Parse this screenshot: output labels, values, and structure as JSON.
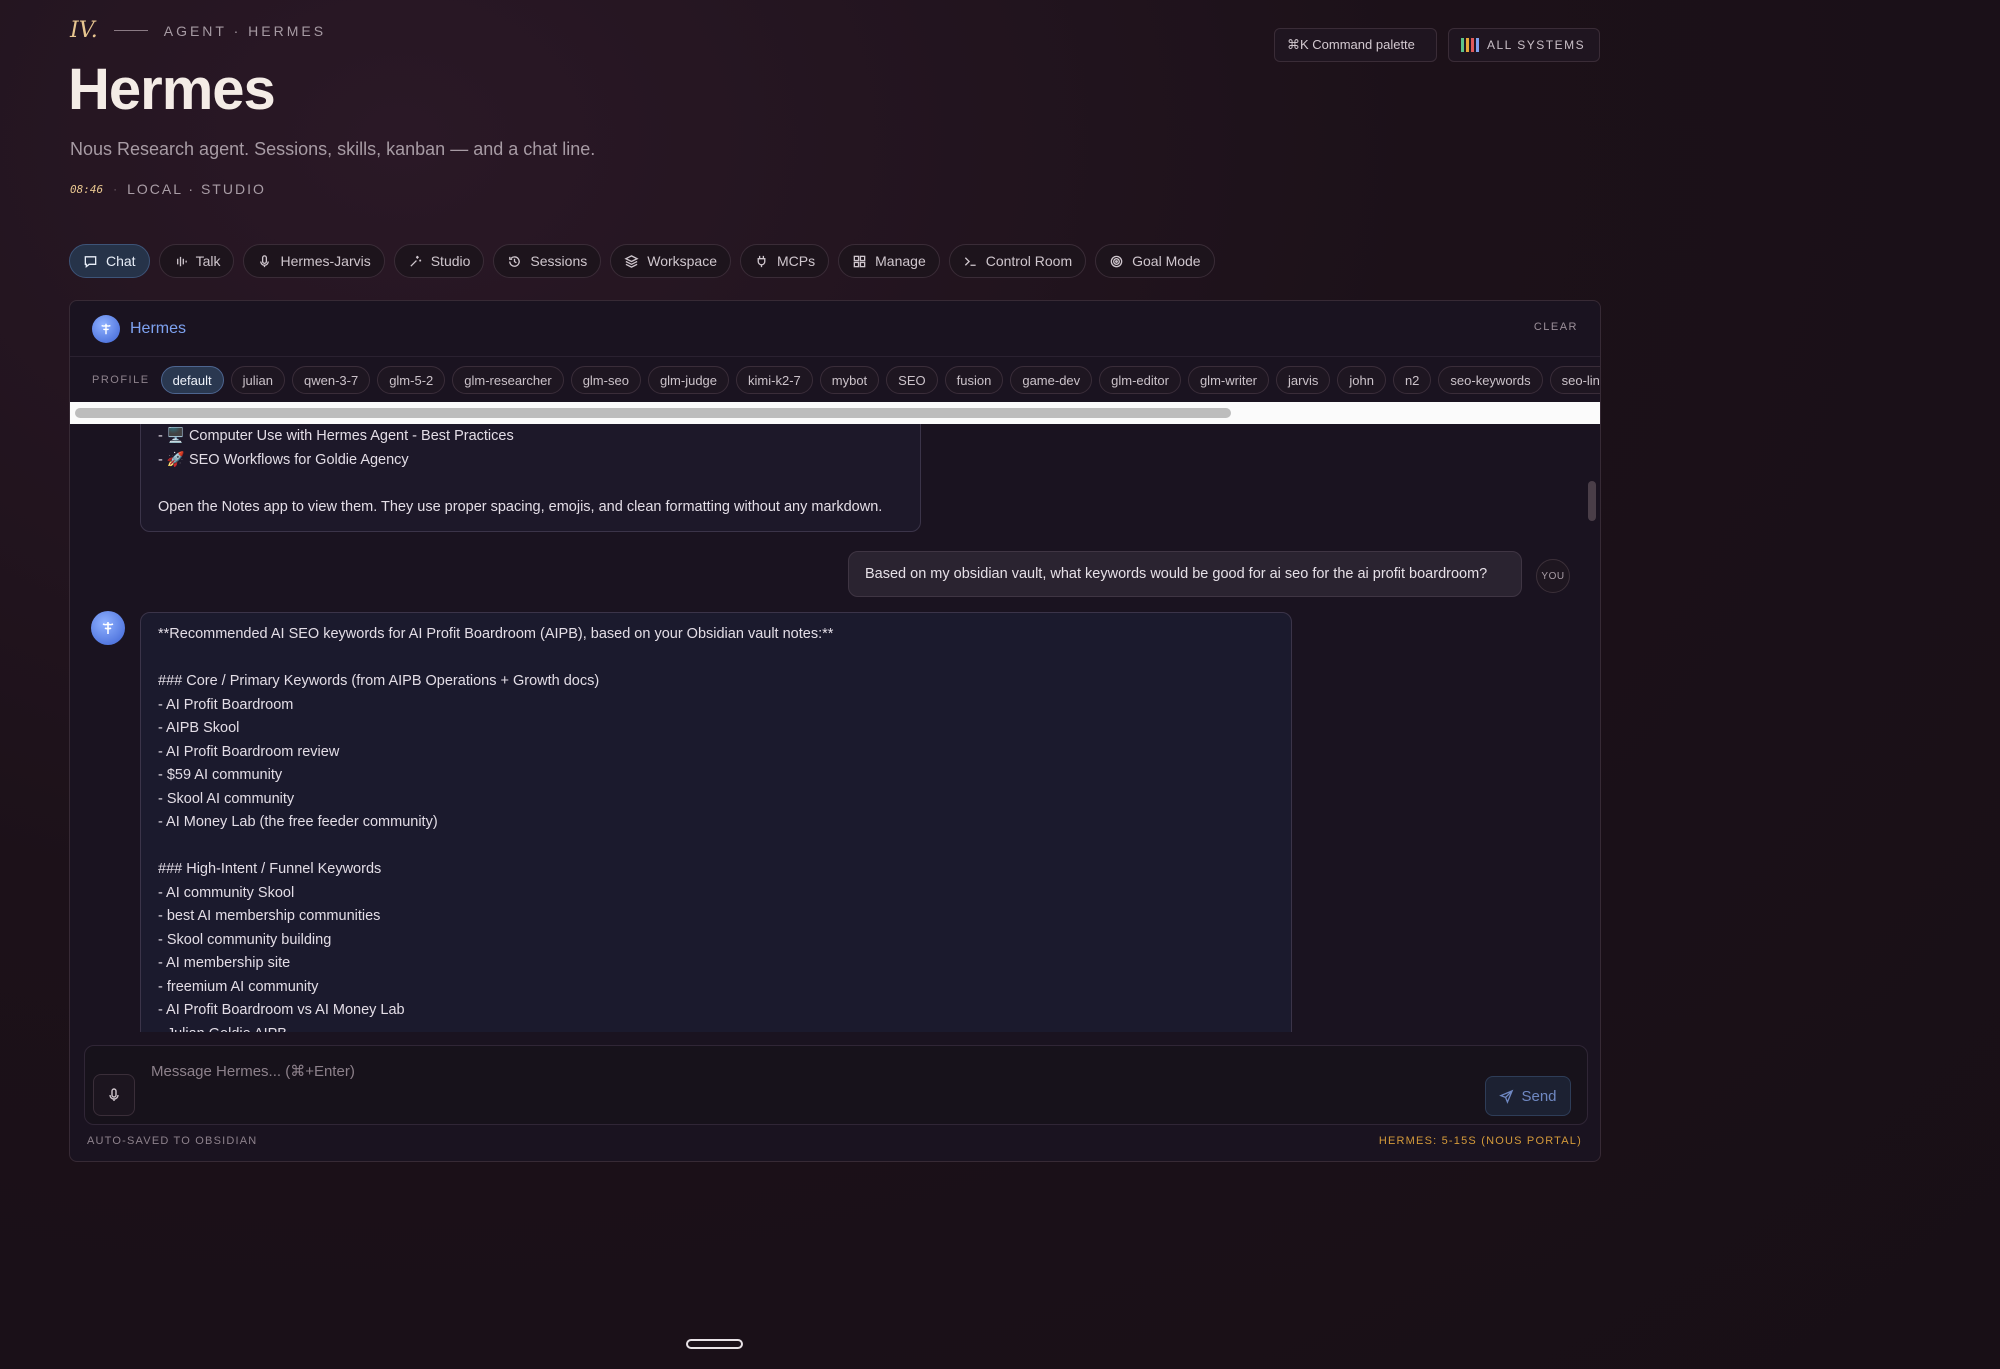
{
  "header": {
    "brand_mark": "IV.",
    "brand_label": "AGENT · HERMES",
    "title": "Hermes",
    "subtitle": "Nous Research agent. Sessions, skills, kanban — and a chat line.",
    "time": "08:46",
    "location": "LOCAL · STUDIO",
    "command_palette": "⌘K Command palette",
    "system_status": "ALL SYSTEMS"
  },
  "colors": {
    "accent_blue": "#7ea2f0",
    "accent_gold": "#e7c58f",
    "status_orange": "#d49a3a",
    "status_bars": [
      "#5cc38a",
      "#e8a83a",
      "#e05a5a",
      "#7ea2f0"
    ]
  },
  "tabs": [
    {
      "label": "Chat",
      "icon": "chat-bubble-icon",
      "active": true
    },
    {
      "label": "Talk",
      "icon": "waveform-icon",
      "active": false
    },
    {
      "label": "Hermes-Jarvis",
      "icon": "microphone-icon",
      "active": false
    },
    {
      "label": "Studio",
      "icon": "sparkles-icon",
      "active": false
    },
    {
      "label": "Sessions",
      "icon": "history-icon",
      "active": false
    },
    {
      "label": "Workspace",
      "icon": "layers-icon",
      "active": false
    },
    {
      "label": "MCPs",
      "icon": "plug-icon",
      "active": false
    },
    {
      "label": "Manage",
      "icon": "grid-icon",
      "active": false
    },
    {
      "label": "Control Room",
      "icon": "terminal-icon",
      "active": false
    },
    {
      "label": "Goal Mode",
      "icon": "target-icon",
      "active": false
    }
  ],
  "panel": {
    "agent_name": "Hermes",
    "clear_label": "CLEAR",
    "profile_label": "PROFILE",
    "profiles": [
      "default",
      "julian",
      "qwen-3-7",
      "glm-5-2",
      "glm-researcher",
      "glm-seo",
      "glm-judge",
      "kimi-k2-7",
      "mybot",
      "SEO",
      "fusion",
      "game-dev",
      "glm-editor",
      "glm-writer",
      "jarvis",
      "john",
      "n2",
      "seo-keywords",
      "seo-links"
    ],
    "active_profile": "default"
  },
  "messages": {
    "prev_assistant": [
      "- 🖥️ Computer Use with Hermes Agent - Best Practices",
      "- 🚀 SEO Workflows for Goldie Agency",
      "",
      "Open the Notes app to view them. They use proper spacing, emojis, and clean formatting without any markdown."
    ],
    "user": "Based on my obsidian vault, what keywords would be good for ai seo for the ai profit boardroom?",
    "user_badge": "YOU",
    "assistant": [
      "**Recommended AI SEO keywords for AI Profit Boardroom (AIPB), based on your Obsidian vault notes:**",
      "",
      "### Core / Primary Keywords (from AIPB Operations + Growth docs)",
      "- AI Profit Boardroom",
      "- AIPB Skool",
      "- AI Profit Boardroom review",
      "- $59 AI community",
      "- Skool AI community",
      "- AI Money Lab (the free feeder community)",
      "",
      "### High-Intent / Funnel Keywords",
      "- AI community Skool",
      "- best AI membership communities",
      "- Skool community building",
      "- AI membership site",
      "- freemium AI community",
      "- AI Profit Boardroom vs AI Money Lab",
      "- Julian Goldie AIPB"
    ]
  },
  "composer": {
    "placeholder": "Message Hermes... (⌘+Enter)",
    "send_label": "Send"
  },
  "footer": {
    "left": "AUTO-SAVED TO OBSIDIAN",
    "right": "HERMES: 5-15S (NOUS PORTAL)"
  }
}
